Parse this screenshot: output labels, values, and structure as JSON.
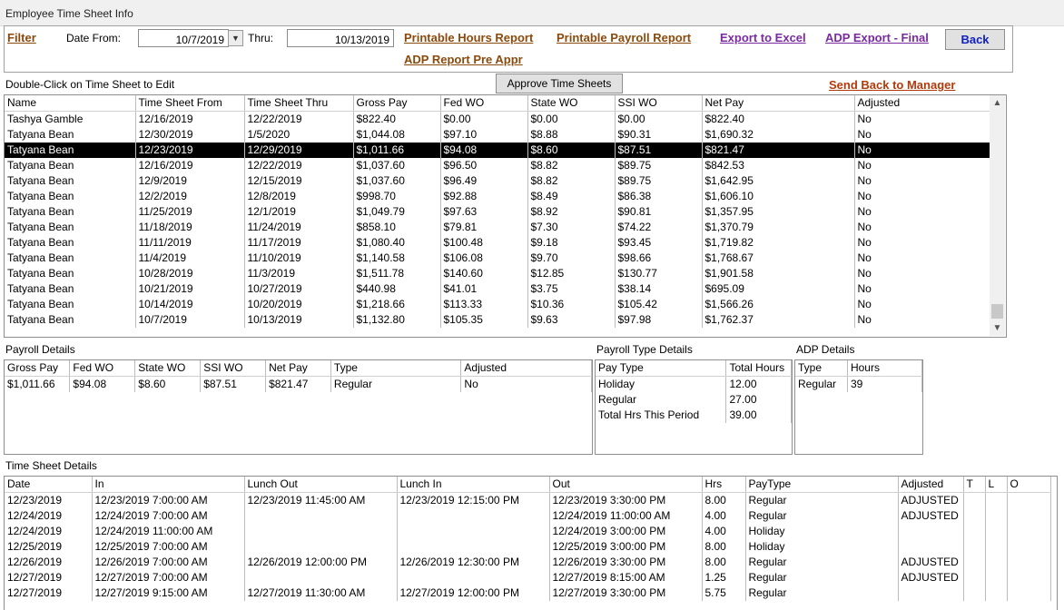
{
  "window": {
    "title": "Employee Time Sheet Info"
  },
  "filter": {
    "filter_label": "Filter",
    "date_from_label": "Date From:",
    "date_from_value": "10/7/2019",
    "thru_label": "Thru:",
    "thru_value": "10/13/2019",
    "printable_hours": "Printable Hours Report",
    "printable_payroll": "Printable Payroll Report",
    "export_excel": "Export to Excel",
    "adp_export_final": "ADP Export - Final",
    "adp_report_pre": "ADP Report Pre Appr",
    "back_label": "Back"
  },
  "timesheets": {
    "hint": "Double-Click on Time Sheet to Edit",
    "approve_label": "Approve Time Sheets",
    "send_back_label": "Send  Back to Manager",
    "columns": [
      "Name",
      "Time Sheet From",
      "Time Sheet Thru",
      "Gross Pay",
      "Fed WO",
      "State WO",
      "SSI WO",
      "Net Pay",
      "Adjusted"
    ],
    "selected_index": 2,
    "rows": [
      [
        "Tashya Gamble",
        "12/16/2019",
        "12/22/2019",
        "$822.40",
        "$0.00",
        "$0.00",
        "$0.00",
        "$822.40",
        "No"
      ],
      [
        "Tatyana Bean",
        "12/30/2019",
        "1/5/2020",
        "$1,044.08",
        "$97.10",
        "$8.88",
        "$90.31",
        "$1,690.32",
        "No"
      ],
      [
        "Tatyana Bean",
        "12/23/2019",
        "12/29/2019",
        "$1,011.66",
        "$94.08",
        "$8.60",
        "$87.51",
        "$821.47",
        "No"
      ],
      [
        "Tatyana Bean",
        "12/16/2019",
        "12/22/2019",
        "$1,037.60",
        "$96.50",
        "$8.82",
        "$89.75",
        "$842.53",
        "No"
      ],
      [
        "Tatyana Bean",
        "12/9/2019",
        "12/15/2019",
        "$1,037.60",
        "$96.49",
        "$8.82",
        "$89.75",
        "$1,642.95",
        "No"
      ],
      [
        "Tatyana Bean",
        "12/2/2019",
        "12/8/2019",
        "$998.70",
        "$92.88",
        "$8.49",
        "$86.38",
        "$1,606.10",
        "No"
      ],
      [
        "Tatyana Bean",
        "11/25/2019",
        "12/1/2019",
        "$1,049.79",
        "$97.63",
        "$8.92",
        "$90.81",
        "$1,357.95",
        "No"
      ],
      [
        "Tatyana Bean",
        "11/18/2019",
        "11/24/2019",
        "$858.10",
        "$79.81",
        "$7.30",
        "$74.22",
        "$1,370.79",
        "No"
      ],
      [
        "Tatyana Bean",
        "11/11/2019",
        "11/17/2019",
        "$1,080.40",
        "$100.48",
        "$9.18",
        "$93.45",
        "$1,719.82",
        "No"
      ],
      [
        "Tatyana Bean",
        "11/4/2019",
        "11/10/2019",
        "$1,140.58",
        "$106.08",
        "$9.70",
        "$98.66",
        "$1,768.67",
        "No"
      ],
      [
        "Tatyana Bean",
        "10/28/2019",
        "11/3/2019",
        "$1,511.78",
        "$140.60",
        "$12.85",
        "$130.77",
        "$1,901.58",
        "No"
      ],
      [
        "Tatyana Bean",
        "10/21/2019",
        "10/27/2019",
        "$440.98",
        "$41.01",
        "$3.75",
        "$38.14",
        "$695.09",
        "No"
      ],
      [
        "Tatyana Bean",
        "10/14/2019",
        "10/20/2019",
        "$1,218.66",
        "$113.33",
        "$10.36",
        "$105.42",
        "$1,566.26",
        "No"
      ],
      [
        "Tatyana Bean",
        "10/7/2019",
        "10/13/2019",
        "$1,132.80",
        "$105.35",
        "$9.63",
        "$97.98",
        "$1,762.37",
        "No"
      ]
    ]
  },
  "payroll_details": {
    "title": "Payroll Details",
    "columns": [
      "Gross Pay",
      "Fed WO",
      "State WO",
      "SSI WO",
      "Net Pay",
      "Type",
      "Adjusted"
    ],
    "rows": [
      [
        "$1,011.66",
        "$94.08",
        "$8.60",
        "$87.51",
        "$821.47",
        "Regular",
        "No"
      ]
    ]
  },
  "payroll_type_details": {
    "title": "Payroll Type Details",
    "columns": [
      "Pay Type",
      "Total Hours"
    ],
    "rows": [
      [
        "Holiday",
        "12.00"
      ],
      [
        "Regular",
        "27.00"
      ],
      [
        "Total Hrs This Period",
        "39.00"
      ]
    ]
  },
  "adp_details": {
    "title": "ADP Details",
    "columns": [
      "Type",
      "Hours"
    ],
    "rows": [
      [
        "Regular",
        "39"
      ]
    ]
  },
  "time_sheet_details": {
    "title": "Time Sheet Details",
    "columns": [
      "Date",
      "In",
      "Lunch Out",
      "Lunch In",
      "Out",
      "Hrs",
      "PayType",
      "Adjusted",
      "T",
      "L",
      "O"
    ],
    "rows": [
      [
        "12/23/2019",
        "12/23/2019 7:00:00 AM",
        "12/23/2019 11:45:00 AM",
        "12/23/2019 12:15:00 PM",
        "12/23/2019 3:30:00 PM",
        "8.00",
        "Regular",
        "ADJUSTED",
        "",
        "",
        ""
      ],
      [
        "12/24/2019",
        "12/24/2019 7:00:00 AM",
        "",
        "",
        "12/24/2019 11:00:00 AM",
        "4.00",
        "Regular",
        "ADJUSTED",
        "",
        "",
        ""
      ],
      [
        "12/24/2019",
        "12/24/2019 11:00:00 AM",
        "",
        "",
        "12/24/2019 3:00:00 PM",
        "4.00",
        "Holiday",
        "",
        "",
        "",
        ""
      ],
      [
        "12/25/2019",
        "12/25/2019 7:00:00 AM",
        "",
        "",
        "12/25/2019 3:00:00 PM",
        "8.00",
        "Holiday",
        "",
        "",
        "",
        ""
      ],
      [
        "12/26/2019",
        "12/26/2019 7:00:00 AM",
        "12/26/2019 12:00:00 PM",
        "12/26/2019 12:30:00 PM",
        "12/26/2019 3:30:00 PM",
        "8.00",
        "Regular",
        "ADJUSTED",
        "",
        "",
        ""
      ],
      [
        "12/27/2019",
        "12/27/2019 7:00:00 AM",
        "",
        "",
        "12/27/2019 8:15:00 AM",
        "1.25",
        "Regular",
        "ADJUSTED",
        "",
        "",
        ""
      ],
      [
        "12/27/2019",
        "12/27/2019 9:15:00 AM",
        "12/27/2019 11:30:00 AM",
        "12/27/2019 12:00:00 PM",
        "12/27/2019 3:30:00 PM",
        "5.75",
        "Regular",
        "",
        "",
        "",
        ""
      ]
    ]
  }
}
